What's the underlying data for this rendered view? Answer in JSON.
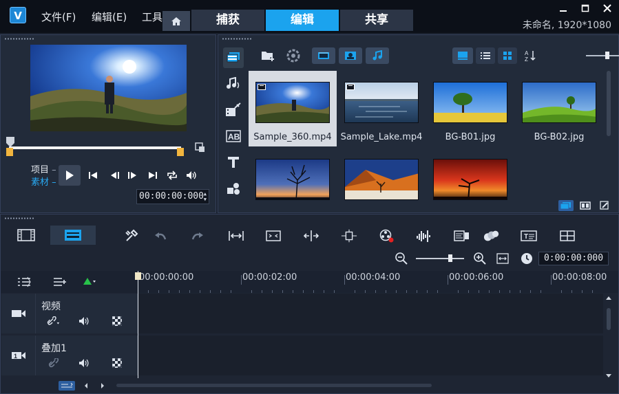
{
  "app": {
    "logo_text": "V",
    "menus": [
      "文件(F)",
      "编辑(E)",
      "工具"
    ],
    "tabs": [
      {
        "label": "捕获",
        "active": false
      },
      {
        "label": "编辑",
        "active": true
      },
      {
        "label": "共享",
        "active": false
      }
    ],
    "project_info": "未命名, 1920*1080",
    "window_controls": [
      "minimize-icon",
      "maximize-icon",
      "close-icon"
    ]
  },
  "player": {
    "mode_project": "项目",
    "mode_clip": "素材",
    "timecode": "00:00:00:000",
    "controls": [
      "play-icon",
      "go-start-icon",
      "prev-frame-icon",
      "next-frame-icon",
      "go-end-icon",
      "repeat-icon",
      "volume-icon"
    ]
  },
  "library": {
    "side_icons": [
      "media-library-icon",
      "audio-icon",
      "effects-icon",
      "transition-title-icon",
      "title-icon",
      "graphics-icon"
    ],
    "toolbar_icons": [
      "add-folder-icon",
      "import-icon",
      "show-videos-icon",
      "show-photos-icon",
      "show-audio-icon",
      "view-storyboard-icon",
      "view-list-icon",
      "view-grid-icon",
      "sort-icon"
    ],
    "thumbnails": [
      {
        "caption": "Sample_360.mp4",
        "video": true,
        "selected": true,
        "art": "panorama"
      },
      {
        "caption": "Sample_Lake.mp4",
        "video": true,
        "selected": false,
        "art": "lake"
      },
      {
        "caption": "BG-B01.jpg",
        "video": false,
        "selected": false,
        "art": "tree-field"
      },
      {
        "caption": "BG-B02.jpg",
        "video": false,
        "selected": false,
        "art": "green-hills"
      },
      {
        "caption": "",
        "video": false,
        "selected": false,
        "art": "sunset-tree"
      },
      {
        "caption": "",
        "video": false,
        "selected": false,
        "art": "desert"
      },
      {
        "caption": "",
        "video": false,
        "selected": false,
        "art": "red-sky"
      }
    ],
    "bottom_icons": [
      "library-panel-icon",
      "options-panel-icon",
      "edit-panel-icon"
    ]
  },
  "timeline": {
    "view_buttons": [
      {
        "name": "storyboard-view",
        "active": false
      },
      {
        "name": "timeline-view",
        "active": true
      }
    ],
    "tools": [
      "tools-icon",
      "undo-icon",
      "redo-icon",
      "smart-proxy-icon",
      "crop-icon",
      "split-icon",
      "motion-icon",
      "record-capture-icon",
      "audio-mixer-icon",
      "subtitle-icon",
      "multicam-icon",
      "title-editor-icon",
      "mask-icon"
    ],
    "timecode": "0:00:00:000",
    "zoom_level": 0.7,
    "ruler_labels": [
      "00:00:00:00",
      "00:00:02:00",
      "00:00:04:00",
      "00:00:06:00",
      "00:00:08:00"
    ],
    "tracks": [
      {
        "name": "视频",
        "icon": "video-track-icon"
      },
      {
        "name": "叠加1",
        "icon": "overlay-track-icon"
      }
    ]
  },
  "colors": {
    "accent": "#1ba3ee",
    "background": "#1b2230",
    "panel": "#222b3a",
    "highlight": "#f2b53e"
  }
}
